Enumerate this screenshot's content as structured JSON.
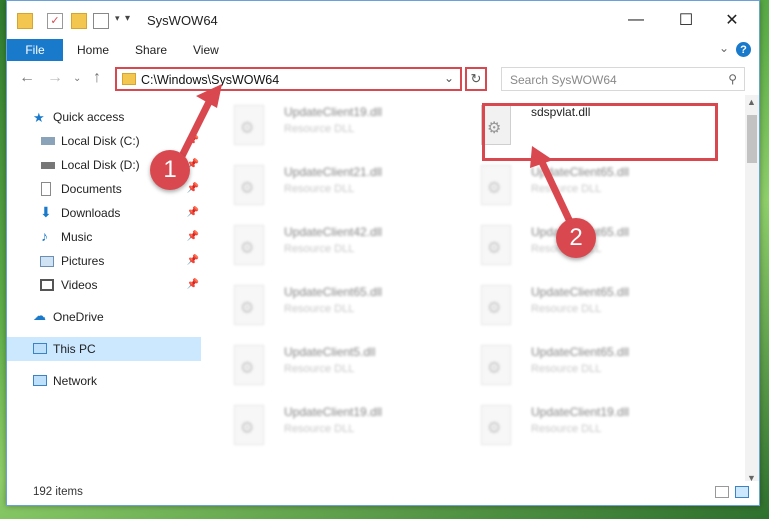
{
  "window": {
    "title": "SysWOW64"
  },
  "ribbon": {
    "file": "File",
    "tabs": [
      "Home",
      "Share",
      "View"
    ]
  },
  "address": {
    "path": "C:\\Windows\\SysWOW64"
  },
  "search": {
    "placeholder": "Search SysWOW64"
  },
  "sidebar": {
    "quick_access": "Quick access",
    "items": [
      "Local Disk (C:)",
      "Local Disk (D:)",
      "Documents",
      "Downloads",
      "Music",
      "Pictures",
      "Videos"
    ],
    "onedrive": "OneDrive",
    "thispc": "This PC",
    "network": "Network"
  },
  "files": {
    "highlight": {
      "name": "sdspvlat.dll"
    },
    "left": [
      "UpdateClient19.dll",
      "UpdateClient21.dll",
      "UpdateClient42.dll",
      "UpdateClient65.dll",
      "UpdateClient5.dll",
      "UpdateClient19.dll"
    ],
    "right": [
      "UpdateClient65.dll",
      "UpdateClient65.dll",
      "UpdateClient65.dll",
      "UpdateClient65.dll",
      "UpdateClient19.dll"
    ],
    "type": "Resource DLL"
  },
  "status": {
    "count": "192 items"
  },
  "annotations": {
    "step1": "1",
    "step2": "2",
    "color": "#d9484f"
  }
}
